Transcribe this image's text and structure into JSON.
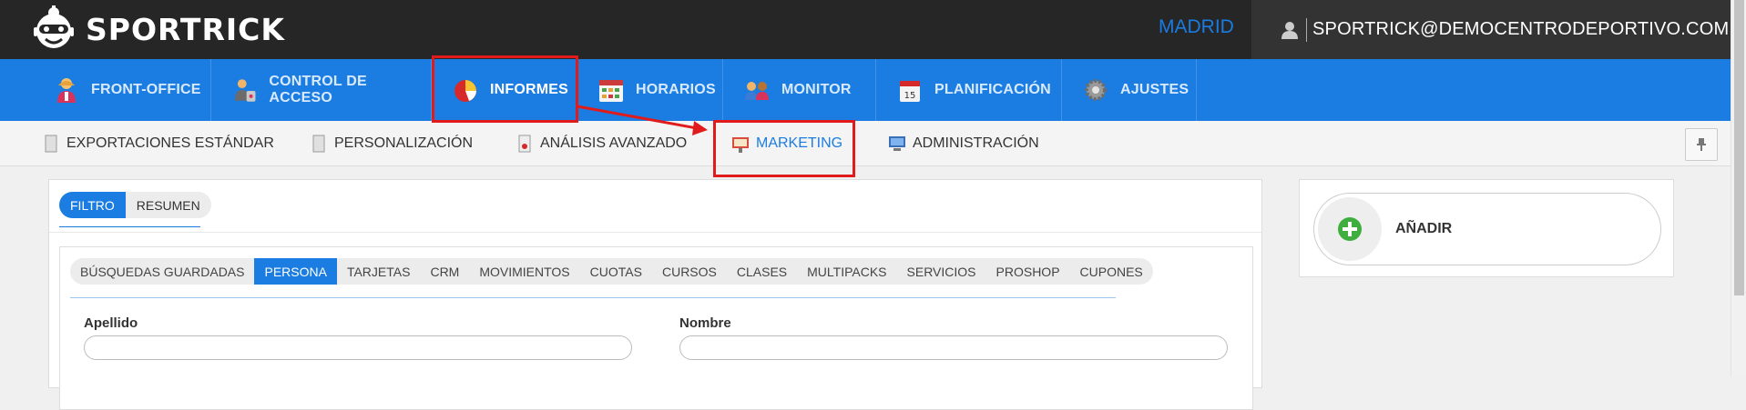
{
  "header": {
    "brand": "SPORTRICK",
    "city": "MADRID",
    "user_email": "SPORTRICK@DEMOCENTRODEPORTIVO.COM"
  },
  "main_nav": [
    {
      "label": "FRONT-OFFICE",
      "icon": "front-office-icon"
    },
    {
      "label": "CONTROL DE ACCESO",
      "icon": "access-control-icon"
    },
    {
      "label": "INFORMES",
      "icon": "pie-chart-icon",
      "active": true
    },
    {
      "label": "HORARIOS",
      "icon": "calendar-icon"
    },
    {
      "label": "MONITOR",
      "icon": "monitor-people-icon"
    },
    {
      "label": "PLANIFICACIÓN",
      "icon": "planner-icon"
    },
    {
      "label": "AJUSTES",
      "icon": "gear-icon"
    }
  ],
  "sub_nav": [
    {
      "label": "EXPORTACIONES ESTÁNDAR",
      "icon": "document-icon"
    },
    {
      "label": "PERSONALIZACIÓN",
      "icon": "document-icon"
    },
    {
      "label": "ANÁLISIS AVANZADO",
      "icon": "analysis-icon"
    },
    {
      "label": "MARKETING",
      "icon": "marketing-icon",
      "active": true
    },
    {
      "label": "ADMINISTRACIÓN",
      "icon": "computer-icon"
    }
  ],
  "panel_tabs": [
    {
      "label": "FILTRO",
      "active": true
    },
    {
      "label": "RESUMEN"
    }
  ],
  "filter_tabs": [
    {
      "label": "BÚSQUEDAS GUARDADAS"
    },
    {
      "label": "PERSONA",
      "active": true
    },
    {
      "label": "TARJETAS"
    },
    {
      "label": "CRM"
    },
    {
      "label": "MOVIMIENTOS"
    },
    {
      "label": "CUOTAS"
    },
    {
      "label": "CURSOS"
    },
    {
      "label": "CLASES"
    },
    {
      "label": "MULTIPACKS"
    },
    {
      "label": "SERVICIOS"
    },
    {
      "label": "PROSHOP"
    },
    {
      "label": "CUPONES"
    }
  ],
  "form": {
    "apellido_label": "Apellido",
    "apellido_value": "",
    "nombre_label": "Nombre",
    "nombre_value": ""
  },
  "add_button": {
    "label": "AÑADIR"
  },
  "colors": {
    "accent": "#1b7de1",
    "header_bg": "#262626",
    "highlight": "#e11b1b"
  }
}
